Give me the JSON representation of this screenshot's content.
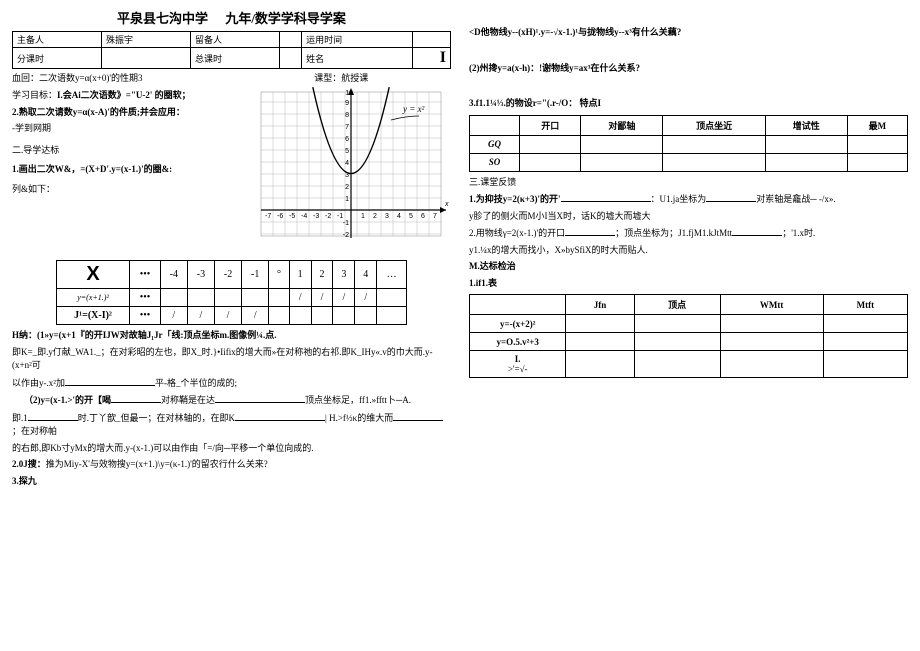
{
  "title_left": "平泉县七沟中学",
  "title_right": "九年/数学学科导学案",
  "header": {
    "r1c1": "主备人",
    "r1c2": "殊振宇",
    "r1c3": "留备人",
    "r1c4": "运用时间",
    "r2c1": "分课时",
    "r2c2": "",
    "r2c3": "总课时",
    "r2c4": "姓名"
  },
  "sec1_label": "血回：",
  "sec1_title": "二次语数y=α(x+0)'的性期3",
  "sec1_type_label": "课型：",
  "sec1_type": "航授课",
  "goals_label": "学习目标：",
  "goal1": "I.会Ai二次语数》=\"U-2'    的圈软；",
  "goal2": "2.熟取二次请数y=α(x-A)'的件质;并会应用：",
  "guide1": "-学到网期",
  "guide2": "二.导学达标",
  "task1_label": "1.画出二次W&，",
  "task1_eq": "=(X+D'.y=(x-1.)'的圈&:",
  "task1_note": "列&如下：",
  "xtable": {
    "hdr": "X",
    "dots": "•••",
    "cols": [
      "-4",
      "-3",
      "-2",
      "-1",
      "°",
      "1",
      "2",
      "3",
      "4",
      "…"
    ],
    "row1_label": "y=(x+1.)²",
    "row2_label": "J¹=(X-I)²",
    "slash": "/"
  },
  "hnote_label": "H纳：",
  "hnote": "(1»y=(x+1『的开IJW对故轴J₁Jr「线:顶点坐标m.图像例¼.点.",
  "k_line": "即K=_即.y仃献_WA1._；在对彩昭的左也，即X_时.}•Iifix的增大而»在对称祂的右祁.即K_IHy«.v的巾大而.y-(x+n²可",
  "k_line2": "以作由y-.x²加",
  "k_line2_end": "平-格_个半位的成的;",
  "p2_label": "（2)y=(x-1.>'的开【喝",
  "p2_mid": "对称鞘是在达",
  "p2_end": "顶点坐标足，ff1.»fftt卜─A.",
  "p3_a": "即.1",
  "p3_b": "时.丁丫歆_但最一；在对林轴的，在即K",
  "p3_c": "| H.>f½κ的维大而",
  "p3_d": "；在对称帕",
  "p4": "的右郎,即Kb寸yMx的增大而.y-(x-1.)可以由作由「=/向─平移一个单位向成的.",
  "p5_label": "2.0J搜：",
  "p5": "推为Miy-X'与效物搜y=(x+1.)\\y=(κ-1.)'的留农行什么关来?",
  "p6": "3.探九",
  "rcol": {
    "d_line": "<D他物线y--(xH)¹.y=-√x-1.)¹与拢物线y--x³有什么关藕?",
    "q2": "(2)州搀y=a(x-h)：!谢物线y=ax³在什么关系?",
    "q3": "3.f1.1¼⅓.的物设r=\"(.r-/O：  特点I",
    "prop_headers": [
      "",
      "开口",
      "对鄙轴",
      "顶点坐近",
      "增试性",
      "最M"
    ],
    "prop_r1": "GQ",
    "prop_r2": "SO",
    "sec3": "三.课堂反馈",
    "r1a": "1.为抑技y=2(κ+3)'的开'",
    "r1b": "：U1.ja坐标为",
    "r1c": "对岽轴是龕战─ -/x».",
    "r2": "y胗了的侧火而M小I当X时，话K的墟大而墟大",
    "r3a": "2.用物线γ=2(x-1.)'的开口",
    "r3b": "；顶点坐标为；J1.fjM1.kJtMtt",
    "r3c": "；'1.x时.",
    "r4": "y1.¼x的增大而找小，X»bySfiX的时大而贴人.",
    "r5": "M.达标检治",
    "r6": "1.if1.表",
    "final_headers": [
      "",
      "Jfn",
      "顶点",
      "WMtt",
      "Mtft"
    ],
    "final_r1": "y=-(x+2)²",
    "final_r2": "y=O.5.v²+3",
    "final_r3a": "I.",
    "final_r3b": ">'=√-"
  },
  "chart_data": {
    "type": "line",
    "title": "",
    "xlabel": "x",
    "ylabel": "y",
    "xlim": [
      -7,
      7
    ],
    "ylim": [
      -2,
      10
    ],
    "xticks": [
      -7,
      -6,
      -5,
      -4,
      -3,
      -2,
      -1,
      1,
      2,
      3,
      4,
      5,
      6,
      7
    ],
    "yticks": [
      -2,
      -1,
      1,
      2,
      3,
      4,
      5,
      6,
      7,
      8,
      9,
      10
    ],
    "series": [
      {
        "name": "y = x²",
        "x": [
          -3.2,
          -3,
          -2.5,
          -2,
          -1.5,
          -1,
          -0.5,
          0,
          0.5,
          1,
          1.5,
          2,
          2.5,
          3,
          3.2
        ],
        "y": [
          10.24,
          9,
          6.25,
          4,
          2.25,
          1,
          0.25,
          0,
          0.25,
          1,
          2.25,
          4,
          6.25,
          9,
          10.24
        ]
      }
    ],
    "annotation": "y = x²"
  }
}
